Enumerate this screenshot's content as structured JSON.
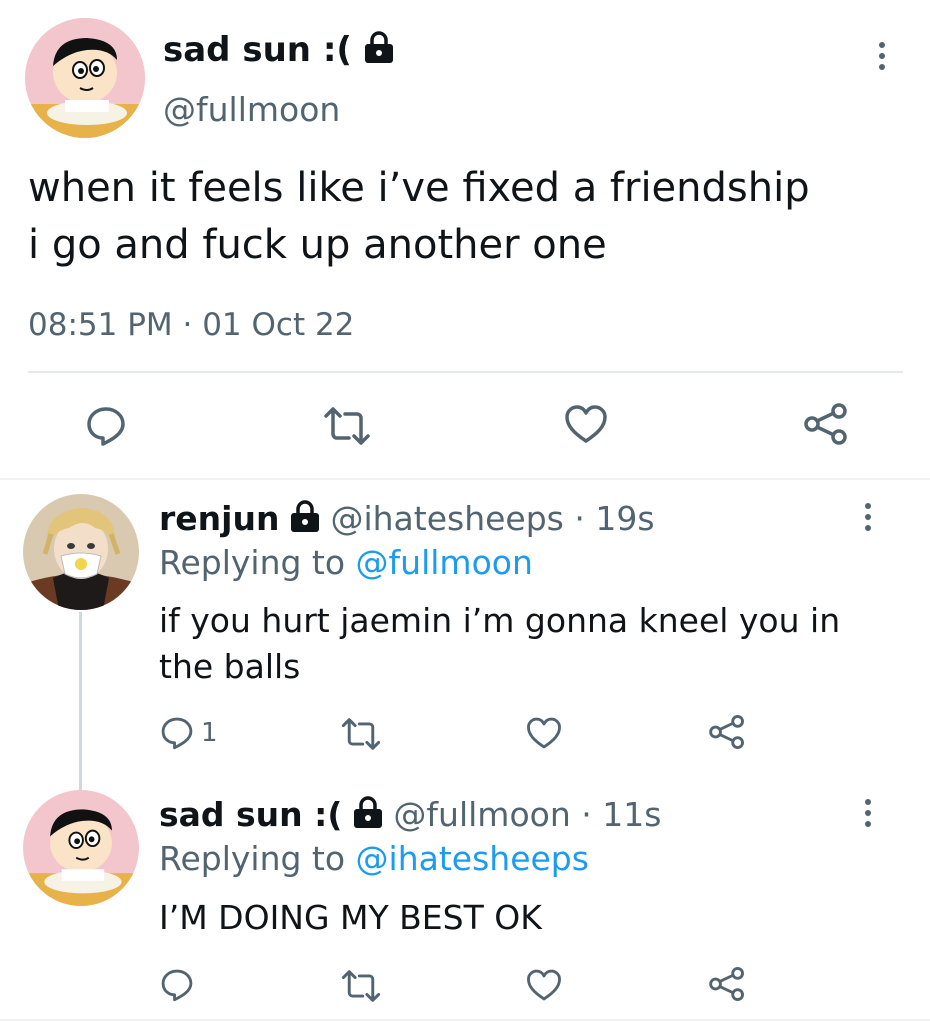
{
  "main_tweet": {
    "display_name": "sad sun :(",
    "handle": "@fullmoon",
    "text_line1": "when it feels like i’ve fixed a friendship",
    "text_line2": "i go and fuck up another one",
    "timestamp": "08:51 PM · 01 Oct 22"
  },
  "reply1": {
    "display_name": "renjun",
    "handle_time": "@ihatesheeps · 19s",
    "replying_prefix": "Replying to ",
    "replying_handle": "@fullmoon",
    "text_line1": "if you hurt jaemin i’m gonna kneel you in",
    "text_line2": "the balls",
    "reply_count": "1"
  },
  "reply2": {
    "display_name": "sad sun :(",
    "handle_time": "@fullmoon · 11s",
    "replying_prefix": "Replying to ",
    "replying_handle": "@ihatesheeps",
    "text": "I’M DOING MY BEST OK"
  },
  "icons": {
    "reply": "reply-icon",
    "retweet": "retweet-icon",
    "like": "heart-icon",
    "share": "share-icon",
    "lock": "lock-icon",
    "more": "more-icon"
  },
  "colors": {
    "text": "#0f1419",
    "secondary": "#536471",
    "link": "#1d9bf0",
    "divider": "#e6e9ec"
  }
}
